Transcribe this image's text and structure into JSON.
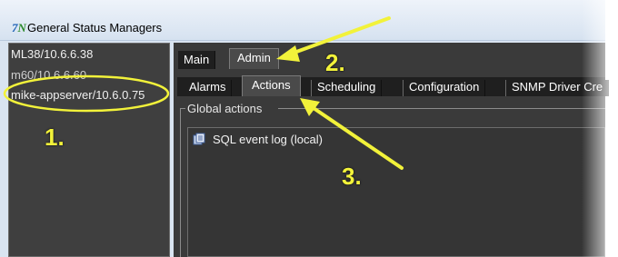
{
  "window": {
    "title": "General Status Managers"
  },
  "servers": [
    {
      "label": "ML38/10.6.6.38"
    },
    {
      "label": "m60/10.6.6.60"
    },
    {
      "label": "mike-appserver/10.6.0.75"
    }
  ],
  "main_tabs": [
    {
      "label": "Main"
    },
    {
      "label": "Admin"
    }
  ],
  "sub_tabs": [
    {
      "label": "Alarms"
    },
    {
      "label": "Actions"
    },
    {
      "label": "Scheduling"
    },
    {
      "label": "Configuration"
    },
    {
      "label": "SNMP Driver Cre"
    }
  ],
  "global_actions": {
    "label": "Global actions",
    "items": [
      {
        "label": "SQL event log (local)",
        "icon": "sql-log-icon"
      }
    ]
  },
  "annotations": [
    {
      "label": "1."
    },
    {
      "label": "2."
    },
    {
      "label": "3."
    }
  ],
  "colors": {
    "annotation": "#f2f23a",
    "panel": "#3a3a3a"
  }
}
